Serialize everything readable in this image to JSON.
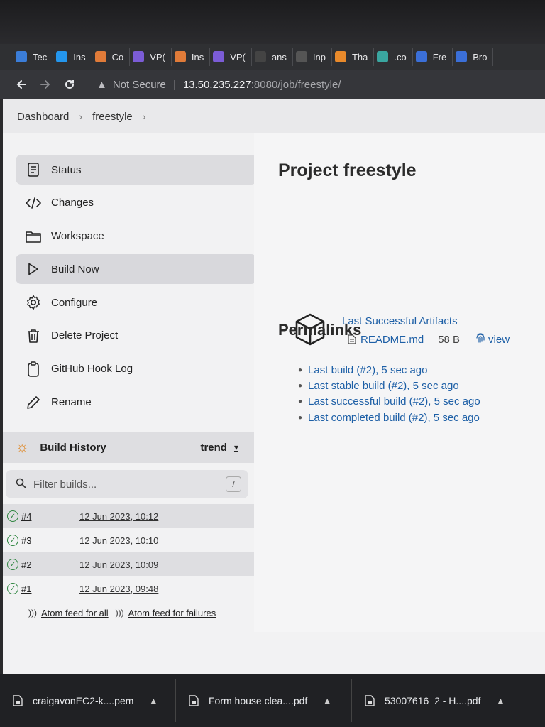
{
  "browser": {
    "tabs": [
      {
        "label": "Tec",
        "icon": "tech-icon",
        "color": "#3b7dd8"
      },
      {
        "label": "Ins",
        "icon": "docker-icon",
        "color": "#2496ed"
      },
      {
        "label": "Co",
        "icon": "aws-icon",
        "color": "#e07b39"
      },
      {
        "label": "VP(",
        "icon": "vpc-icon",
        "color": "#7b5cd6"
      },
      {
        "label": "Ins",
        "icon": "aws-icon",
        "color": "#e07b39"
      },
      {
        "label": "VP(",
        "icon": "vpc-icon",
        "color": "#7b5cd6"
      },
      {
        "label": "ans",
        "icon": "github-icon",
        "color": "#444444"
      },
      {
        "label": "Inp",
        "icon": "generic-icon",
        "color": "#555555"
      },
      {
        "label": "Tha",
        "icon": "two-icon",
        "color": "#e98a2b"
      },
      {
        "label": ".co",
        "icon": "chatgpt-icon",
        "color": "#3aa6a0"
      },
      {
        "label": "Fre",
        "icon": "c-icon",
        "color": "#3b6fd8"
      },
      {
        "label": "Bro",
        "icon": "c-icon",
        "color": "#3b6fd8"
      }
    ],
    "security_label": "Not Secure",
    "url_host": "13.50.235.227",
    "url_path": ":8080/job/freestyle/"
  },
  "breadcrumb": {
    "items": [
      "Dashboard",
      "freestyle"
    ]
  },
  "sidebar": {
    "items": [
      {
        "label": "Status",
        "icon": "document-icon"
      },
      {
        "label": "Changes",
        "icon": "code-icon"
      },
      {
        "label": "Workspace",
        "icon": "folder-icon"
      },
      {
        "label": "Build Now",
        "icon": "play-icon"
      },
      {
        "label": "Configure",
        "icon": "gear-icon"
      },
      {
        "label": "Delete Project",
        "icon": "trash-icon"
      },
      {
        "label": "GitHub Hook Log",
        "icon": "clipboard-icon"
      },
      {
        "label": "Rename",
        "icon": "pencil-icon"
      }
    ]
  },
  "build_history": {
    "title": "Build History",
    "trend_label": "trend",
    "filter_placeholder": "Filter builds...",
    "filter_shortcut": "/",
    "builds": [
      {
        "number": "#4",
        "date": "12 Jun 2023, 10:12"
      },
      {
        "number": "#3",
        "date": "12 Jun 2023, 10:10"
      },
      {
        "number": "#2",
        "date": "12 Jun 2023, 10:09"
      },
      {
        "number": "#1",
        "date": "12 Jun 2023, 09:48"
      }
    ],
    "feed_all": "Atom feed for all",
    "feed_failures": "Atom feed for failures"
  },
  "main": {
    "title": "Project freestyle",
    "artifacts_link": "Last Successful Artifacts",
    "artifact_file": "README.md",
    "artifact_size": "58 B",
    "artifact_view": "view",
    "permalinks_title": "Permalinks",
    "permalinks": [
      "Last build (#2), 5 sec ago",
      "Last stable build (#2), 5 sec ago",
      "Last successful build (#2), 5 sec ago",
      "Last completed build (#2), 5 sec ago"
    ]
  },
  "downloads": [
    {
      "name": "craigavonEC2-k....pem"
    },
    {
      "name": "Form house clea....pdf"
    },
    {
      "name": "53007616_2 - H....pdf"
    }
  ]
}
